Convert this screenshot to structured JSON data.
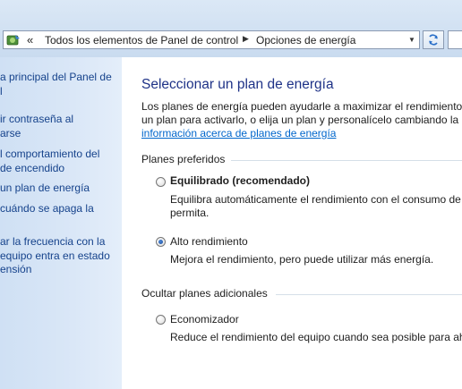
{
  "address_bar": {
    "chevron": "«",
    "segments": [
      "Todos los elementos de Panel de control",
      "Opciones de energía"
    ],
    "icon": "control-panel-icon"
  },
  "nav": {
    "items": [
      {
        "lines": [
          "a principal del Panel de",
          "l"
        ]
      },
      {
        "lines": [
          "ir contraseña al",
          "arse"
        ]
      },
      {
        "lines": [
          "l comportamiento del",
          " de encendido"
        ]
      },
      {
        "lines": [
          "un plan de energía"
        ]
      },
      {
        "lines": [
          "cuándo se apaga la"
        ]
      },
      {
        "lines": [
          "ar la frecuencia con la",
          "equipo entra en estado",
          "ensión"
        ]
      }
    ]
  },
  "main": {
    "title": "Seleccionar un plan de energía",
    "description_lines": [
      "Los planes de energía pueden ayudarle a maximizar el rendimiento o",
      "un plan para activarlo, o elija un plan y personalícelo cambiando la c"
    ],
    "description_link": "información acerca de planes de energía",
    "preferred_label": "Planes preferidos",
    "hidden_label": "Ocultar planes adicionales",
    "plans": [
      {
        "name": "Equilibrado (recomendado)",
        "desc_lines": [
          "Equilibra automáticamente el rendimiento con el consumo de",
          "permita."
        ],
        "selected": false
      },
      {
        "name": "Alto rendimiento",
        "desc_lines": [
          "Mejora el rendimiento, pero puede utilizar más energía."
        ],
        "selected": true
      },
      {
        "name": "Economizador",
        "desc_lines": [
          "Reduce el rendimiento del equipo cuando sea posible para ah"
        ],
        "selected": false
      }
    ]
  },
  "colors": {
    "title": "#1e3287",
    "link": "#0066cc",
    "nav_text": "#15428b",
    "nav_bg": "#dae7f7"
  }
}
